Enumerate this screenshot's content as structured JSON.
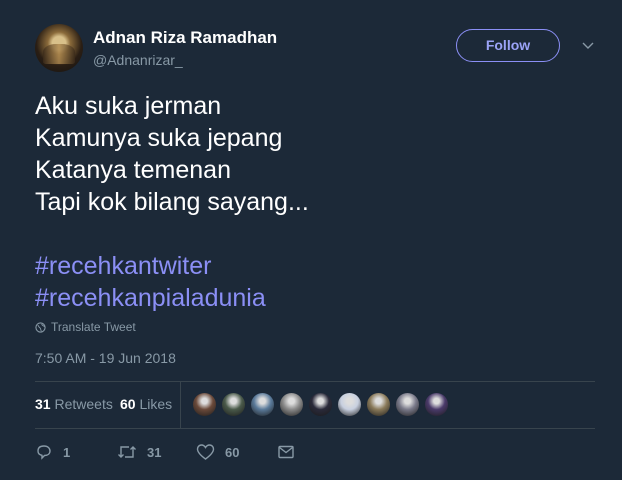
{
  "user": {
    "name": "Adnan Riza Ramadhan",
    "handle": "@Adnanrizar_",
    "follow_label": "Follow"
  },
  "tweet": {
    "lines": [
      "Aku suka jerman",
      "Kamunya suka jepang",
      "Katanya temenan",
      "Tapi kok bilang sayang..."
    ],
    "hashtags": [
      "#recehkantwiter",
      "#recehkanpialadunia"
    ],
    "translate_label": "Translate Tweet",
    "timestamp": "7:50 AM - 19 Jun 2018"
  },
  "stats": {
    "retweets_count": "31",
    "retweets_label": "Retweets",
    "likes_count": "60",
    "likes_label": "Likes"
  },
  "likers": [
    {
      "color": "#6b4a3a"
    },
    {
      "color": "#4a5a4a"
    },
    {
      "color": "#5a7a9a"
    },
    {
      "color": "#8a8a8a"
    },
    {
      "color": "#2a2a3a"
    },
    {
      "color": "#c8d0e0"
    },
    {
      "color": "#8a7a5a"
    },
    {
      "color": "#7a7a8a"
    },
    {
      "color": "#4a3a6a"
    }
  ],
  "actions": {
    "reply_count": "1",
    "retweet_count": "31",
    "like_count": "60"
  },
  "colors": {
    "background": "#1c2938",
    "accent": "#8b8ff5",
    "muted": "#8899a6",
    "divider": "#38444d"
  }
}
